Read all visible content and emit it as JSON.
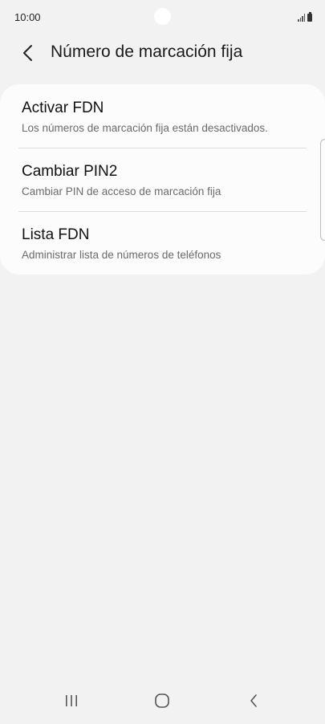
{
  "status_bar": {
    "time": "10:00"
  },
  "header": {
    "title": "Número de marcación fija",
    "back_icon": "chevron-left-icon"
  },
  "settings": {
    "items": [
      {
        "title": "Activar FDN",
        "subtitle": "Los números de marcación fija están desactivados."
      },
      {
        "title": "Cambiar PIN2",
        "subtitle": "Cambiar PIN de acceso de marcación fija"
      },
      {
        "title": "Lista FDN",
        "subtitle": "Administrar lista de números de teléfonos"
      }
    ]
  },
  "nav_bar": {
    "recents_icon": "recent-apps-icon",
    "home_icon": "home-icon",
    "back_icon": "back-icon"
  },
  "colors": {
    "background": "#f2f2f2",
    "card": "#fcfcfc",
    "subtitle": "#6b6b6b",
    "divider": "#dcdcdc"
  }
}
